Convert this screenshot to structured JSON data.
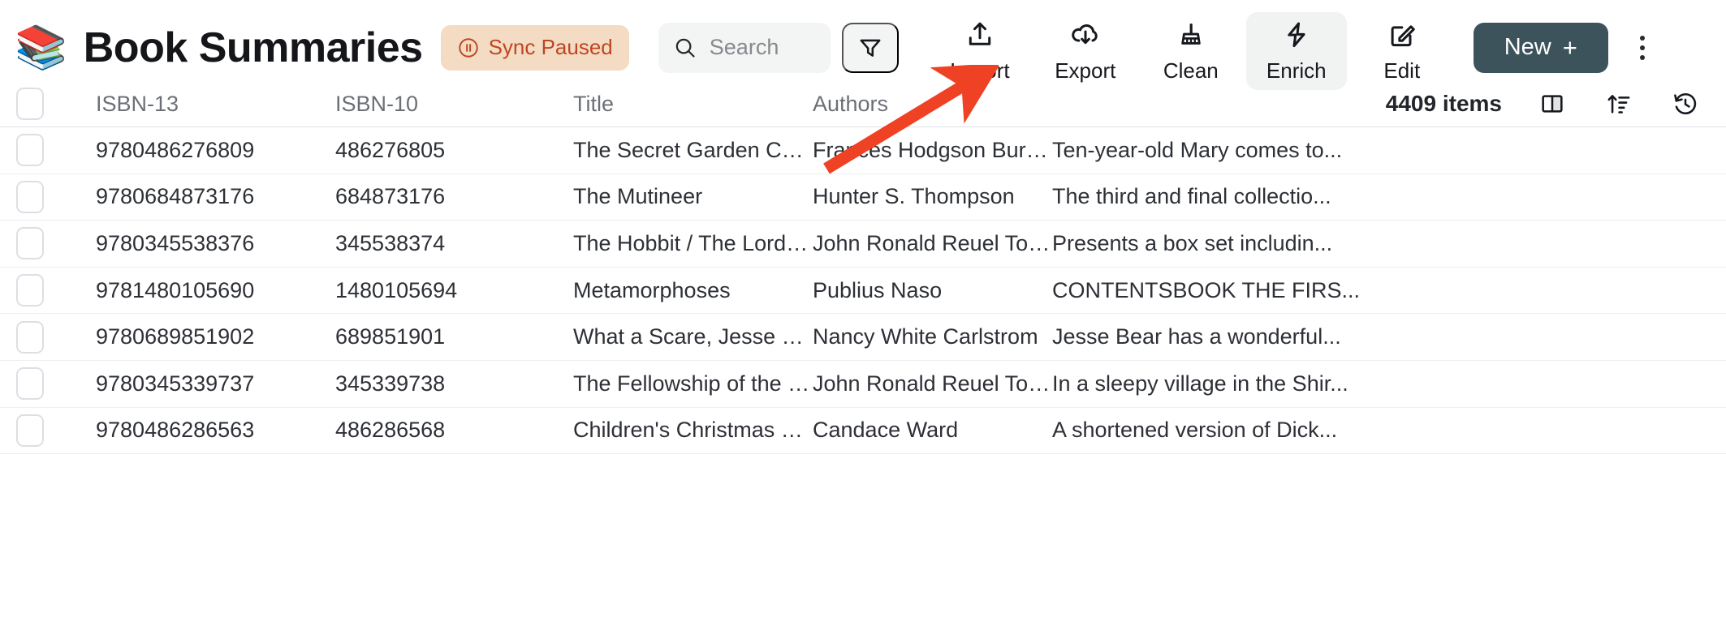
{
  "header": {
    "app_icon": "books-icon",
    "title": "Book Summaries",
    "sync_badge": {
      "icon": "pause-circle-icon",
      "label": "Sync Paused",
      "bg_color": "#f4dcc4",
      "text_color": "#bf4622"
    },
    "search": {
      "icon": "search-icon",
      "value": "",
      "placeholder": "Search"
    },
    "filter_button": {
      "icon": "funnel-icon"
    },
    "actions": [
      {
        "id": "import",
        "icon": "upload-icon",
        "label": "Import",
        "active": false
      },
      {
        "id": "export",
        "icon": "cloud-download-icon",
        "label": "Export",
        "active": false
      },
      {
        "id": "clean",
        "icon": "broom-icon",
        "label": "Clean",
        "active": false
      },
      {
        "id": "enrich",
        "icon": "lightning-icon",
        "label": "Enrich",
        "active": true
      },
      {
        "id": "edit",
        "icon": "pencil-square-icon",
        "label": "Edit",
        "active": false
      }
    ],
    "new_button": {
      "label": "New",
      "plus": "+",
      "bg_color": "#3c535b"
    },
    "overflow_button": {
      "icon": "kebab-menu-icon"
    }
  },
  "table": {
    "columns": [
      "ISBN-13",
      "ISBN-10",
      "Title",
      "Authors",
      ""
    ],
    "item_count": "4409 items",
    "header_icons": [
      {
        "id": "split-view",
        "icon": "split-panel-icon"
      },
      {
        "id": "sort",
        "icon": "sort-ascending-icon"
      },
      {
        "id": "history",
        "icon": "history-clock-icon"
      }
    ],
    "rows": [
      {
        "isbn13": "9780486276809",
        "isbn10": "486276805",
        "title": "The Secret Garden Coloring ...",
        "authors": "Frances Hodgson Burnett",
        "summary": "Ten-year-old Mary comes to..."
      },
      {
        "isbn13": "9780684873176",
        "isbn10": "684873176",
        "title": "The Mutineer",
        "authors": "Hunter S. Thompson",
        "summary": "The third and final collectio..."
      },
      {
        "isbn13": "9780345538376",
        "isbn10": "345538374",
        "title": "The Hobbit / The Lord of th...",
        "authors": "John Ronald Reuel Tolkien",
        "summary": "Presents a box set includin..."
      },
      {
        "isbn13": "9781480105690",
        "isbn10": "1480105694",
        "title": "Metamorphoses",
        "authors": "Publius Naso",
        "summary": "CONTENTSBOOK THE FIRS..."
      },
      {
        "isbn13": "9780689851902",
        "isbn10": "689851901",
        "title": "What a Scare, Jesse Bear",
        "authors": "Nancy White Carlstrom",
        "summary": "Jesse Bear has a wonderful..."
      },
      {
        "isbn13": "9780345339737",
        "isbn10": "345339738",
        "title": "The Fellowship of the Ring",
        "authors": "John Ronald Reuel Tolkien",
        "summary": "In a sleepy village in the Shir..."
      },
      {
        "isbn13": "9780486286563",
        "isbn10": "486286568",
        "title": "Children's Christmas Stories...",
        "authors": "Candace Ward",
        "summary": "A shortened version of Dick..."
      }
    ]
  },
  "annotation": {
    "type": "arrow",
    "color": "#ef4123",
    "points_to": "enrich"
  }
}
